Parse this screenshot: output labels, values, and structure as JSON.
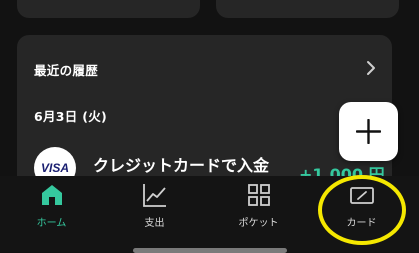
{
  "history": {
    "title": "最近の履歴",
    "date": "6月3日 (火)",
    "transaction": {
      "brand": "VISA",
      "name": "クレジットカードで入金",
      "amount": "+1,000 円"
    }
  },
  "tabbar": {
    "tabs": [
      {
        "label": "ホーム",
        "icon": "home-icon",
        "active": true
      },
      {
        "label": "支出",
        "icon": "chart-icon",
        "active": false
      },
      {
        "label": "ポケット",
        "icon": "grid-icon",
        "active": false
      },
      {
        "label": "カード",
        "icon": "card-icon",
        "active": false
      }
    ]
  },
  "colors": {
    "accent": "#35c89e",
    "background": "#121212",
    "card": "#262626",
    "highlight": "#f5e800"
  }
}
